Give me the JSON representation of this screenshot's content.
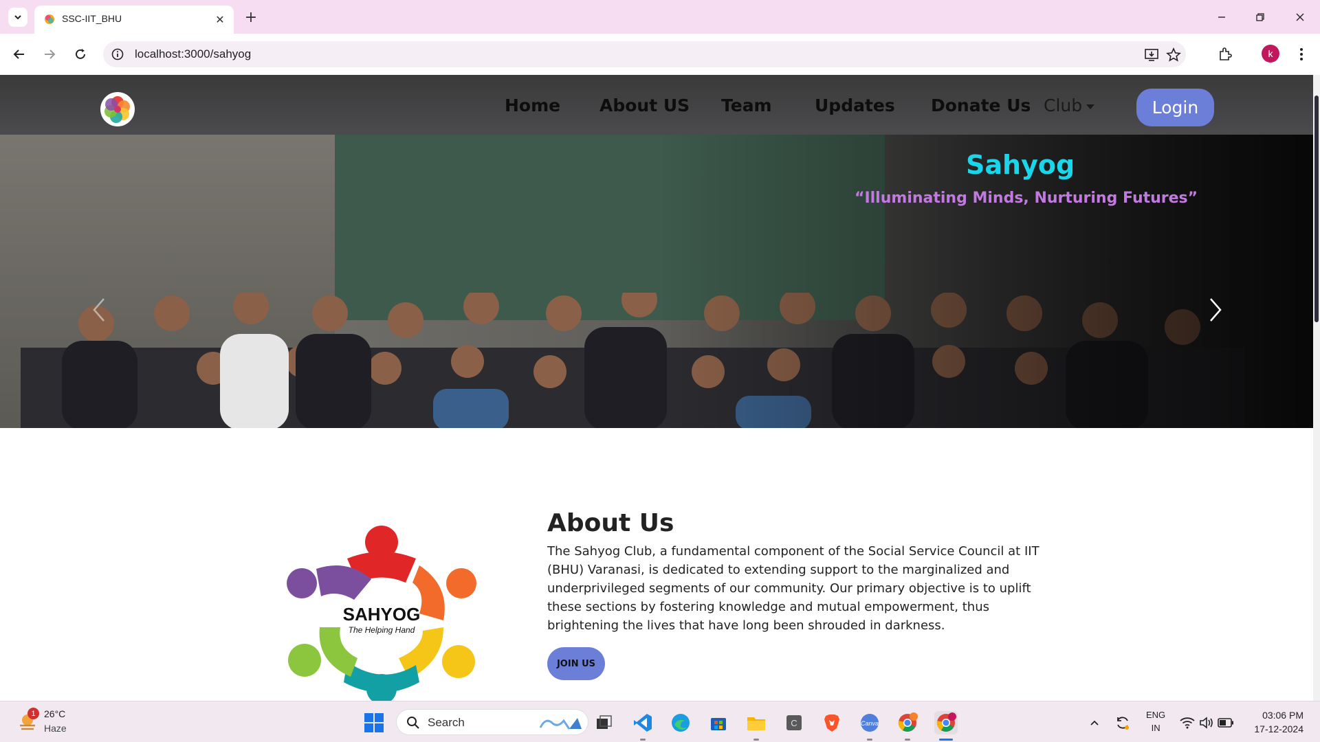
{
  "browser": {
    "tab_title": "SSC-IIT_BHU",
    "url": "localhost:3000/sahyog",
    "profile_initial": "k"
  },
  "site": {
    "nav": {
      "home": "Home",
      "about": "About US",
      "team": "Team",
      "updates": "Updates",
      "donate": "Donate Us",
      "club": "Club",
      "login": "Login"
    },
    "hero": {
      "title": "Sahyog",
      "subtitle": "“Illuminating Minds, Nurturing Futures”"
    },
    "about": {
      "heading": "About Us",
      "body": "The Sahyog Club, a fundamental component of the Social Service Council at IIT (BHU) Varanasi, is dedicated to extending support to the marginalized and underprivileged segments of our community. Our primary objective is to uplift these sections by fostering knowledge and mutual empowerment, thus brightening the lives that have long been shrouded in darkness.",
      "join_label": "JOIN US",
      "logo_text": "SAHYOG",
      "logo_tagline": "The Helping Hand"
    }
  },
  "taskbar": {
    "weather_temp": "26°C",
    "weather_cond": "Haze",
    "weather_badge": "1",
    "search_label": "Search",
    "lang_1": "ENG",
    "lang_2": "IN",
    "time": "03:06 PM",
    "date": "17-12-2024"
  },
  "colors": {
    "accent": "#6c7fd8",
    "hero_title": "#19d6ea",
    "hero_subtitle": "#c27ae0",
    "tabstrip": "#f7ddf1"
  }
}
